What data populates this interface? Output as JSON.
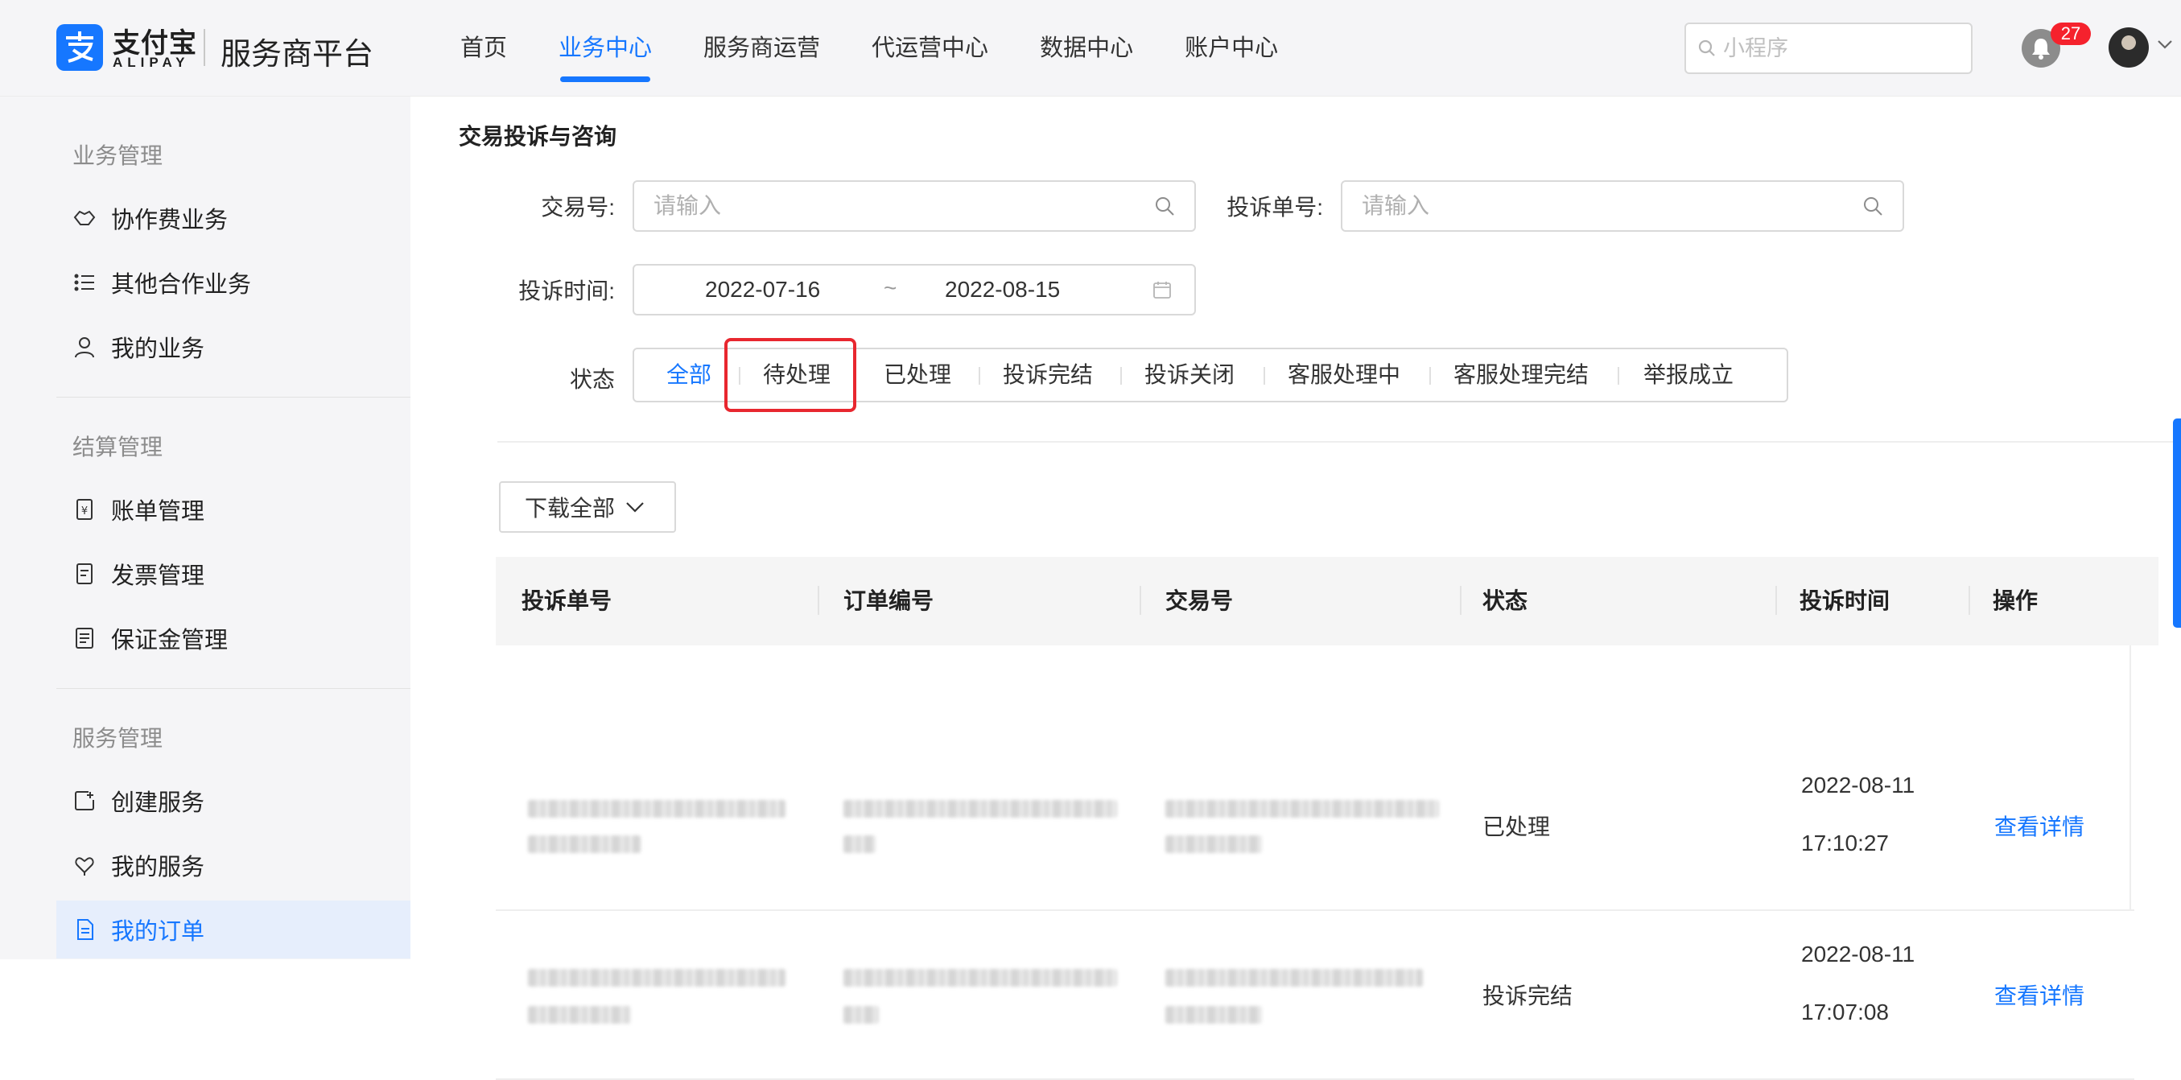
{
  "header": {
    "brand_cn": "支付宝",
    "brand_en": "ALIPAY",
    "platform": "服务商平台",
    "nav": [
      {
        "label": "首页",
        "active": false
      },
      {
        "label": "业务中心",
        "active": true
      },
      {
        "label": "服务商运营",
        "active": false
      },
      {
        "label": "代运营中心",
        "active": false
      },
      {
        "label": "数据中心",
        "active": false
      },
      {
        "label": "账户中心",
        "active": false
      }
    ],
    "search_placeholder": "小程序",
    "notification_count": "27",
    "accent_color": "#1677ff"
  },
  "sidebar": {
    "groups": [
      {
        "title": "业务管理",
        "items": [
          "协作费业务",
          "其他合作业务",
          "我的业务"
        ]
      },
      {
        "title": "结算管理",
        "items": [
          "账单管理",
          "发票管理",
          "保证金管理"
        ]
      },
      {
        "title": "服务管理",
        "items": [
          "创建服务",
          "我的服务",
          "我的订单"
        ]
      }
    ],
    "active_item": "我的订单"
  },
  "main": {
    "title": "交易投诉与咨询",
    "filters": {
      "trade_no_label": "交易号:",
      "trade_no_placeholder": "请输入",
      "complaint_no_label": "投诉单号:",
      "complaint_no_placeholder": "请输入",
      "time_label": "投诉时间:",
      "date_start": "2022-07-16",
      "date_sep": "~",
      "date_end": "2022-08-15",
      "status_label": "状态"
    },
    "status_tabs": [
      "全部",
      "待处理",
      "已处理",
      "投诉完结",
      "投诉关闭",
      "客服处理中",
      "客服处理完结",
      "举报成立"
    ],
    "active_status": "全部",
    "highlighted_status": "待处理",
    "download_label": "下载全部",
    "table": {
      "columns": [
        "投诉单号",
        "订单编号",
        "交易号",
        "状态",
        "投诉时间",
        "操作"
      ],
      "rows": [
        {
          "status": "已处理",
          "date": "2022-08-11",
          "time": "17:10:27",
          "action": "查看详情"
        },
        {
          "status": "投诉完结",
          "date": "2022-08-11",
          "time": "17:07:08",
          "action": "查看详情"
        }
      ]
    }
  }
}
